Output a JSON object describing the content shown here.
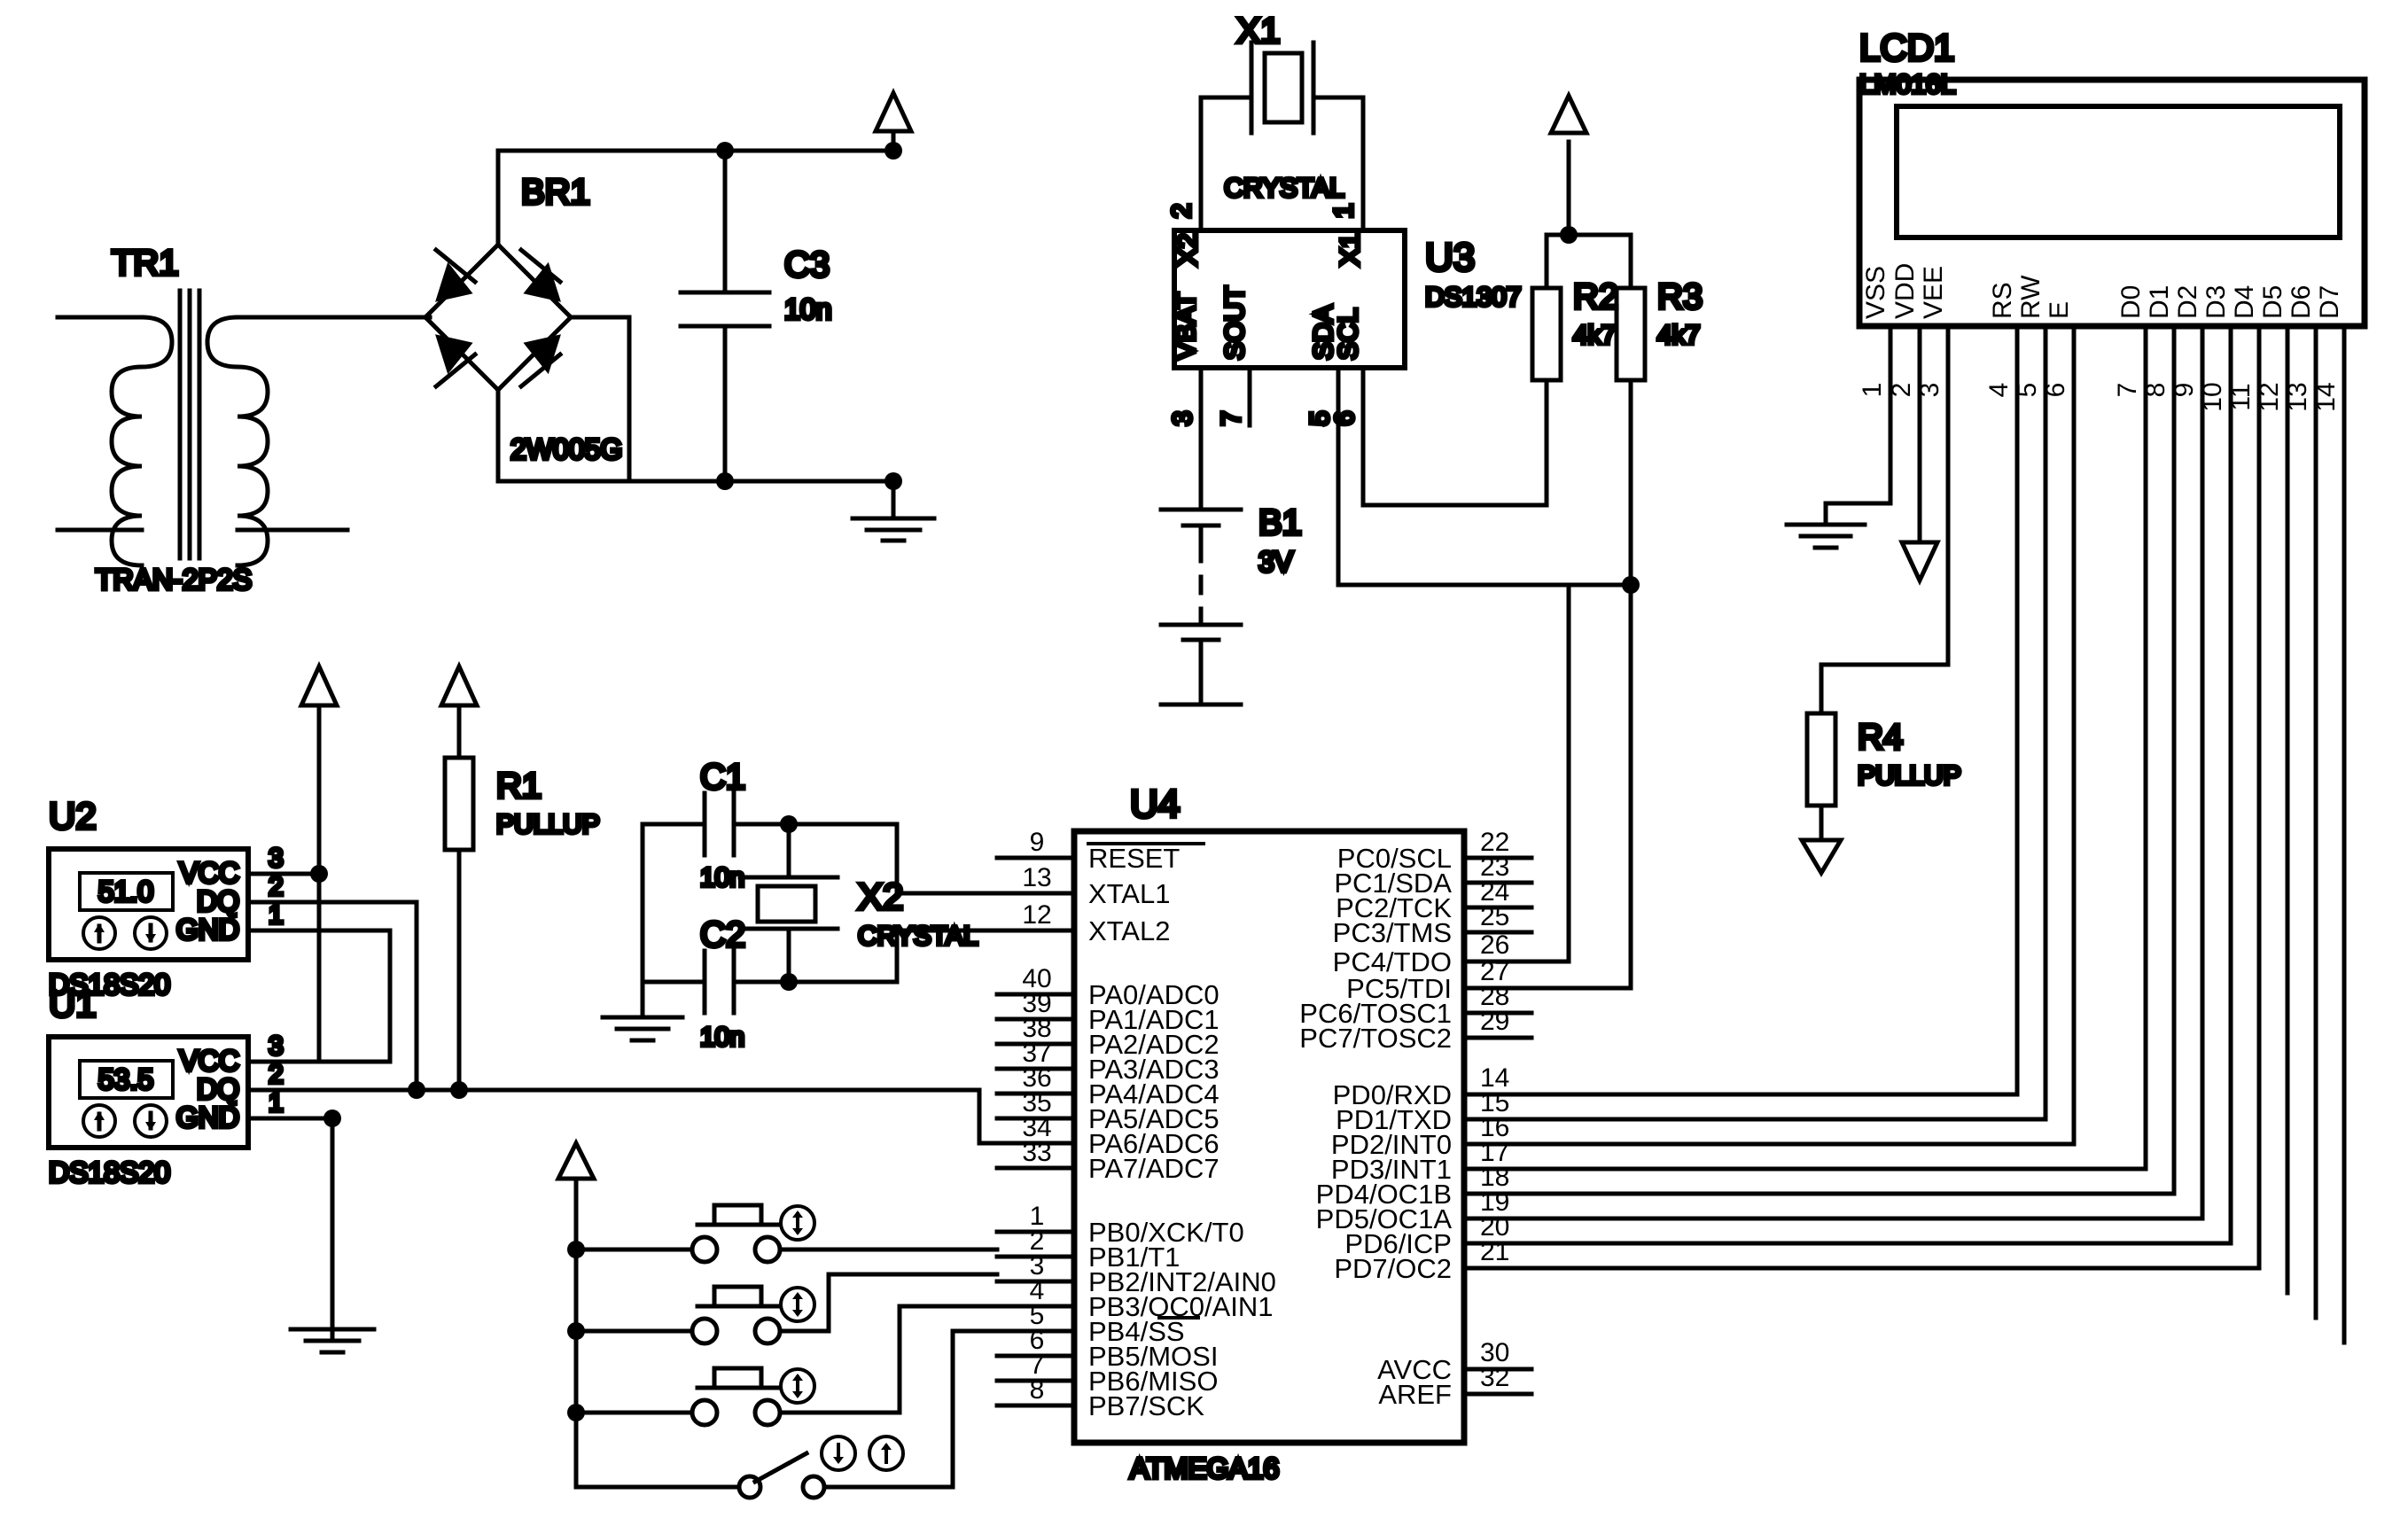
{
  "schematic": {
    "title": "ATMEGA16 data-logger schematic",
    "line_color": "#000000",
    "background": "#ffffff"
  },
  "power_supply": {
    "transformer": {
      "ref": "TR1",
      "value": "TRAN-2P2S"
    },
    "bridge": {
      "ref": "BR1",
      "value": "2W005G"
    },
    "capacitor": {
      "ref": "C3",
      "value": "10n"
    }
  },
  "rtc": {
    "crystal": {
      "ref": "X1",
      "value": "CRYSTAL",
      "pin_left": "2",
      "pin_right": "1"
    },
    "chip": {
      "ref": "U3",
      "value": "DS1307",
      "pins_top": [
        {
          "name": "X2",
          "num": "2"
        },
        {
          "name": "X1",
          "num": "1"
        }
      ],
      "pins_bottom": [
        {
          "name": "VBAT",
          "num": "3"
        },
        {
          "name": "SOUT",
          "num": "7"
        },
        {
          "name": "SDA",
          "num": "5"
        },
        {
          "name": "SCL",
          "num": "6"
        }
      ]
    },
    "battery": {
      "ref": "B1",
      "value": "3V"
    },
    "pullups": [
      {
        "ref": "R2",
        "value": "4k7"
      },
      {
        "ref": "R3",
        "value": "4k7"
      }
    ]
  },
  "lcd": {
    "ref": "LCD1",
    "value": "LM016L",
    "pins": [
      {
        "name": "VSS",
        "num": "1"
      },
      {
        "name": "VDD",
        "num": "2"
      },
      {
        "name": "VEE",
        "num": "3"
      },
      {
        "name": "RS",
        "num": "4"
      },
      {
        "name": "RW",
        "num": "5"
      },
      {
        "name": "E",
        "num": "6"
      },
      {
        "name": "D0",
        "num": "7"
      },
      {
        "name": "D1",
        "num": "8"
      },
      {
        "name": "D2",
        "num": "9"
      },
      {
        "name": "D3",
        "num": "10"
      },
      {
        "name": "D4",
        "num": "11"
      },
      {
        "name": "D5",
        "num": "12"
      },
      {
        "name": "D6",
        "num": "13"
      },
      {
        "name": "D7",
        "num": "14"
      }
    ],
    "contrast_pullup": {
      "ref": "R4",
      "value": "PULLUP"
    }
  },
  "sensors": {
    "pullup": {
      "ref": "R1",
      "value": "PULLUP"
    },
    "items": [
      {
        "ref": "U2",
        "value": "DS18S20",
        "reading": "51.0",
        "pins": [
          {
            "name": "VCC",
            "num": "3"
          },
          {
            "name": "DQ",
            "num": "2"
          },
          {
            "name": "GND",
            "num": "1"
          }
        ]
      },
      {
        "ref": "U1",
        "value": "DS18S20",
        "reading": "53.5",
        "pins": [
          {
            "name": "VCC",
            "num": "3"
          },
          {
            "name": "DQ",
            "num": "2"
          },
          {
            "name": "GND",
            "num": "1"
          }
        ]
      }
    ]
  },
  "mcu_clock": {
    "crystal": {
      "ref": "X2",
      "value": "CRYSTAL"
    },
    "caps": [
      {
        "ref": "C1",
        "value": "10n"
      },
      {
        "ref": "C2",
        "value": "10n"
      }
    ]
  },
  "mcu": {
    "ref": "U4",
    "value": "ATMEGA16",
    "pins_left": [
      {
        "name": "RESET",
        "num": "9",
        "overline": true
      },
      {
        "name": "XTAL1",
        "num": "13"
      },
      {
        "name": "XTAL2",
        "num": "12"
      },
      {
        "name": "PA0/ADC0",
        "num": "40"
      },
      {
        "name": "PA1/ADC1",
        "num": "39"
      },
      {
        "name": "PA2/ADC2",
        "num": "38"
      },
      {
        "name": "PA3/ADC3",
        "num": "37"
      },
      {
        "name": "PA4/ADC4",
        "num": "36"
      },
      {
        "name": "PA5/ADC5",
        "num": "35"
      },
      {
        "name": "PA6/ADC6",
        "num": "34"
      },
      {
        "name": "PA7/ADC7",
        "num": "33"
      },
      {
        "name": "PB0/XCK/T0",
        "num": "1"
      },
      {
        "name": "PB1/T1",
        "num": "2"
      },
      {
        "name": "PB2/INT2/AIN0",
        "num": "3"
      },
      {
        "name": "PB3/OC0/AIN1",
        "num": "4"
      },
      {
        "name": "PB4/SS",
        "num": "5",
        "overline_tail": "SS"
      },
      {
        "name": "PB5/MOSI",
        "num": "6"
      },
      {
        "name": "PB6/MISO",
        "num": "7"
      },
      {
        "name": "PB7/SCK",
        "num": "8"
      }
    ],
    "pins_right": [
      {
        "name": "PC0/SCL",
        "num": "22"
      },
      {
        "name": "PC1/SDA",
        "num": "23"
      },
      {
        "name": "PC2/TCK",
        "num": "24"
      },
      {
        "name": "PC3/TMS",
        "num": "25"
      },
      {
        "name": "PC4/TDO",
        "num": "26"
      },
      {
        "name": "PC5/TDI",
        "num": "27"
      },
      {
        "name": "PC6/TOSC1",
        "num": "28"
      },
      {
        "name": "PC7/TOSC2",
        "num": "29"
      },
      {
        "name": "PD0/RXD",
        "num": "14"
      },
      {
        "name": "PD1/TXD",
        "num": "15"
      },
      {
        "name": "PD2/INT0",
        "num": "16"
      },
      {
        "name": "PD3/INT1",
        "num": "17"
      },
      {
        "name": "PD4/OC1B",
        "num": "18"
      },
      {
        "name": "PD5/OC1A",
        "num": "19"
      },
      {
        "name": "PD6/ICP",
        "num": "20"
      },
      {
        "name": "PD7/OC2",
        "num": "21"
      },
      {
        "name": "AVCC",
        "num": "30"
      },
      {
        "name": "AREF",
        "num": "32"
      }
    ]
  },
  "inputs": {
    "buttons": [
      {
        "name": "button-1",
        "actuator": "up-down-icon"
      },
      {
        "name": "button-2",
        "actuator": "up-down-icon"
      },
      {
        "name": "button-3",
        "actuator": "up-down-icon"
      }
    ],
    "toggle_switch": {
      "name": "toggle-switch",
      "actuators": [
        "down-icon",
        "up-icon"
      ]
    }
  }
}
